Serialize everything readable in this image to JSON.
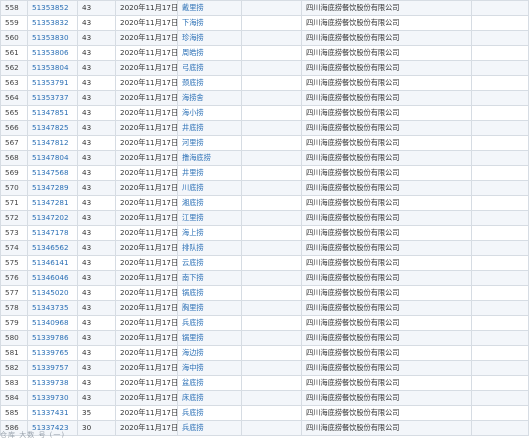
{
  "rows": [
    {
      "no": "558",
      "reg": "51353852",
      "cls": "43",
      "date": "2020年11月17日",
      "name": "戴里捞",
      "applicant": "四川海底捞餐饮股份有限公司"
    },
    {
      "no": "559",
      "reg": "51353832",
      "cls": "43",
      "date": "2020年11月17日",
      "name": "下海捞",
      "applicant": "四川海底捞餐饮股份有限公司"
    },
    {
      "no": "560",
      "reg": "51353830",
      "cls": "43",
      "date": "2020年11月17日",
      "name": "珍海捞",
      "applicant": "四川海底捞餐饮股份有限公司"
    },
    {
      "no": "561",
      "reg": "51353806",
      "cls": "43",
      "date": "2020年11月17日",
      "name": "周皓捞",
      "applicant": "四川海底捞餐饮股份有限公司"
    },
    {
      "no": "562",
      "reg": "51353804",
      "cls": "43",
      "date": "2020年11月17日",
      "name": "弓底捞",
      "applicant": "四川海底捞餐饮股份有限公司"
    },
    {
      "no": "563",
      "reg": "51353791",
      "cls": "43",
      "date": "2020年11月17日",
      "name": "颈底捞",
      "applicant": "四川海底捞餐饮股份有限公司"
    },
    {
      "no": "564",
      "reg": "51353737",
      "cls": "43",
      "date": "2020年11月17日",
      "name": "海捞舍",
      "applicant": "四川海底捞餐饮股份有限公司"
    },
    {
      "no": "565",
      "reg": "51347851",
      "cls": "43",
      "date": "2020年11月17日",
      "name": "海小捞",
      "applicant": "四川海底捞餐饮股份有限公司"
    },
    {
      "no": "566",
      "reg": "51347825",
      "cls": "43",
      "date": "2020年11月17日",
      "name": "井底捞",
      "applicant": "四川海底捞餐饮股份有限公司"
    },
    {
      "no": "567",
      "reg": "51347812",
      "cls": "43",
      "date": "2020年11月17日",
      "name": "河里捞",
      "applicant": "四川海底捞餐饮股份有限公司"
    },
    {
      "no": "568",
      "reg": "51347804",
      "cls": "43",
      "date": "2020年11月17日",
      "name": "撸海底捞",
      "applicant": "四川海底捞餐饮股份有限公司"
    },
    {
      "no": "569",
      "reg": "51347568",
      "cls": "43",
      "date": "2020年11月17日",
      "name": "井里捞",
      "applicant": "四川海底捞餐饮股份有限公司"
    },
    {
      "no": "570",
      "reg": "51347289",
      "cls": "43",
      "date": "2020年11月17日",
      "name": "川底捞",
      "applicant": "四川海底捞餐饮股份有限公司"
    },
    {
      "no": "571",
      "reg": "51347281",
      "cls": "43",
      "date": "2020年11月17日",
      "name": "湘底捞",
      "applicant": "四川海底捞餐饮股份有限公司"
    },
    {
      "no": "572",
      "reg": "51347202",
      "cls": "43",
      "date": "2020年11月17日",
      "name": "江里捞",
      "applicant": "四川海底捞餐饮股份有限公司"
    },
    {
      "no": "573",
      "reg": "51347178",
      "cls": "43",
      "date": "2020年11月17日",
      "name": "海上捞",
      "applicant": "四川海底捞餐饮股份有限公司"
    },
    {
      "no": "574",
      "reg": "51346562",
      "cls": "43",
      "date": "2020年11月17日",
      "name": "排队捞",
      "applicant": "四川海底捞餐饮股份有限公司"
    },
    {
      "no": "575",
      "reg": "51346141",
      "cls": "43",
      "date": "2020年11月17日",
      "name": "云底捞",
      "applicant": "四川海底捞餐饮股份有限公司"
    },
    {
      "no": "576",
      "reg": "51346046",
      "cls": "43",
      "date": "2020年11月17日",
      "name": "南下捞",
      "applicant": "四川海底捞餐饮股份有限公司"
    },
    {
      "no": "577",
      "reg": "51345020",
      "cls": "43",
      "date": "2020年11月17日",
      "name": "锅底捞",
      "applicant": "四川海底捞餐饮股份有限公司"
    },
    {
      "no": "578",
      "reg": "51343735",
      "cls": "43",
      "date": "2020年11月17日",
      "name": "胸里捞",
      "applicant": "四川海底捞餐饮股份有限公司"
    },
    {
      "no": "579",
      "reg": "51340968",
      "cls": "43",
      "date": "2020年11月17日",
      "name": "兵底捞",
      "applicant": "四川海底捞餐饮股份有限公司"
    },
    {
      "no": "580",
      "reg": "51339786",
      "cls": "43",
      "date": "2020年11月17日",
      "name": "锅里捞",
      "applicant": "四川海底捞餐饮股份有限公司"
    },
    {
      "no": "581",
      "reg": "51339765",
      "cls": "43",
      "date": "2020年11月17日",
      "name": "海边捞",
      "applicant": "四川海底捞餐饮股份有限公司"
    },
    {
      "no": "582",
      "reg": "51339757",
      "cls": "43",
      "date": "2020年11月17日",
      "name": "海中捞",
      "applicant": "四川海底捞餐饮股份有限公司"
    },
    {
      "no": "583",
      "reg": "51339738",
      "cls": "43",
      "date": "2020年11月17日",
      "name": "盆底捞",
      "applicant": "四川海底捞餐饮股份有限公司"
    },
    {
      "no": "584",
      "reg": "51339730",
      "cls": "43",
      "date": "2020年11月17日",
      "name": "床底捞",
      "applicant": "四川海底捞餐饮股份有限公司"
    },
    {
      "no": "585",
      "reg": "51337431",
      "cls": "35",
      "date": "2020年11月17日",
      "name": "兵底捞",
      "applicant": "四川海底捞餐饮股份有限公司"
    },
    {
      "no": "586",
      "reg": "51337423",
      "cls": "30",
      "date": "2020年11月17日",
      "name": "兵底捞",
      "applicant": "四川海底捞餐饮股份有限公司"
    }
  ],
  "footer_partial": "仓库 大数 号 (一)"
}
